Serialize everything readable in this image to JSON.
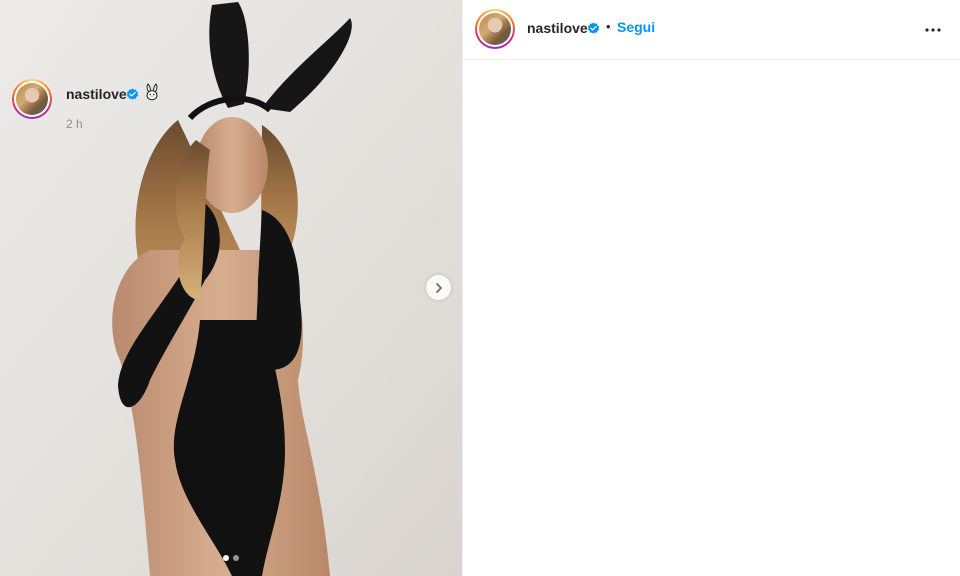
{
  "post": {
    "author": "nastilove",
    "verified": true,
    "follow_label": "Segui",
    "separator": "•",
    "more_icon": "more-horizontal-icon"
  },
  "caption": {
    "author": "nastilove",
    "emoji_icon": "rabbit-face-icon",
    "time": "2 h"
  },
  "media": {
    "slides_total": 2,
    "active_slide": 1,
    "next_icon": "chevron-right-icon"
  },
  "colors": {
    "accent": "#0095f6",
    "verified": "#0095f6",
    "text": "#262626",
    "muted": "#8e8e8e"
  }
}
